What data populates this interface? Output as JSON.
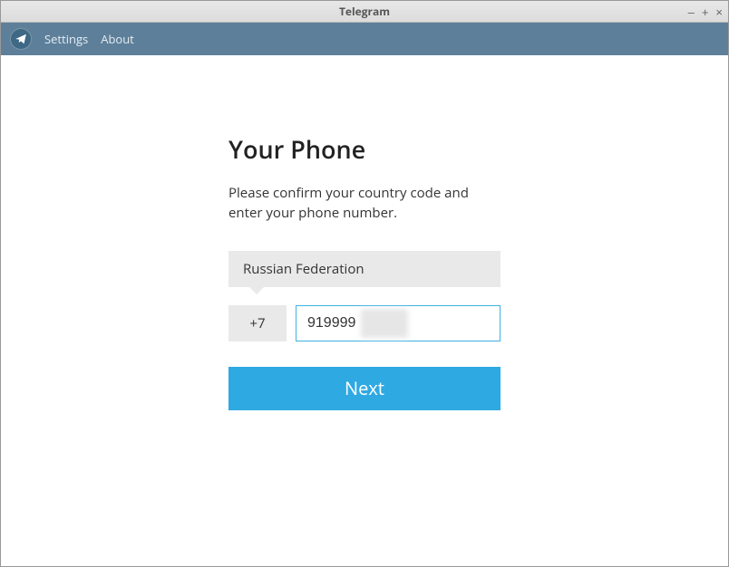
{
  "window": {
    "title": "Telegram"
  },
  "menubar": {
    "settings": "Settings",
    "about": "About"
  },
  "form": {
    "heading": "Your Phone",
    "subtext": "Please confirm your country code and enter your phone number.",
    "country": "Russian Federation",
    "code": "+7",
    "phone_value": "919999",
    "next_label": "Next"
  }
}
